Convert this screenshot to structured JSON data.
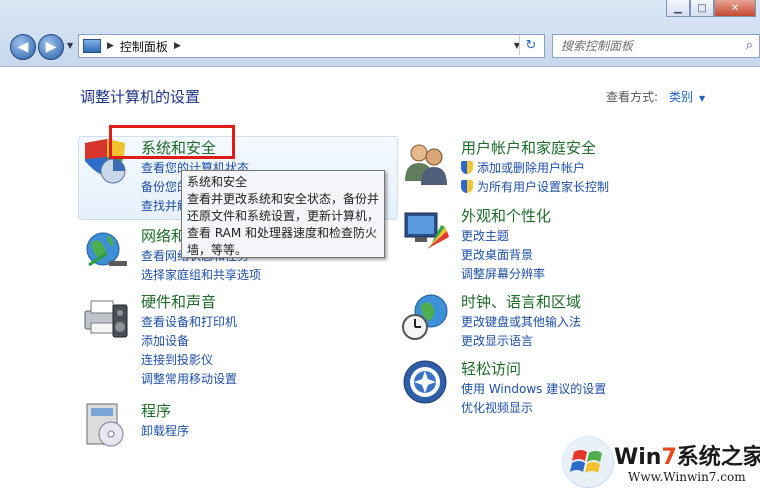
{
  "address_bar": {
    "crumb": "控制面板"
  },
  "search": {
    "placeholder": "搜索控制面板"
  },
  "main": {
    "title": "调整计算机的设置",
    "view_by_label": "查看方式:",
    "view_by_value": "类别"
  },
  "categories": [
    {
      "title": "系统和安全",
      "links": [
        "查看您的计算机状态",
        "备份您的计算机",
        "查找并解决问题"
      ]
    },
    {
      "title": "网络和 Internet",
      "links": [
        "查看网络状态和任务",
        "选择家庭组和共享选项"
      ]
    },
    {
      "title": "硬件和声音",
      "links": [
        "查看设备和打印机",
        "添加设备",
        "连接到投影仪",
        "调整常用移动设置"
      ]
    },
    {
      "title": "程序",
      "links": [
        "卸载程序"
      ]
    },
    {
      "title": "用户帐户和家庭安全",
      "links": [
        "添加或删除用户帐户",
        "为所有用户设置家长控制"
      ]
    },
    {
      "title": "外观和个性化",
      "links": [
        "更改主题",
        "更改桌面背景",
        "调整屏幕分辨率"
      ]
    },
    {
      "title": "时钟、语言和区域",
      "links": [
        "更改键盘或其他输入法",
        "更改显示语言"
      ]
    },
    {
      "title": "轻松访问",
      "links": [
        "使用 Windows 建议的设置",
        "优化视频显示"
      ]
    }
  ],
  "tooltip": {
    "title": "系统和安全",
    "body": "查看并更改系统和安全状态，备份并还原文件和系统设置，更新计算机，查看 RAM 和处理器速度和检查防火墙，等等。"
  },
  "watermark": {
    "brand_prefix": "Win",
    "brand_seven": "7",
    "brand_suffix": "系统之家",
    "url": "Www.Winwin7.com"
  },
  "colors": {
    "accent_link": "#1e4fa8",
    "category_title": "#1e6b2a",
    "page_title": "#1e3287",
    "highlight_box": "#e11a1a"
  }
}
